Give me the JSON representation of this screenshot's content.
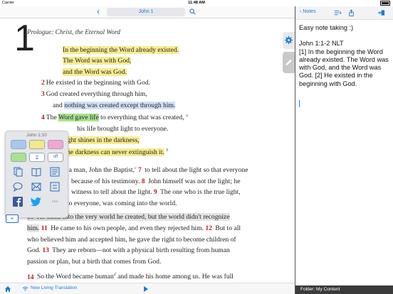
{
  "status": {
    "carrier": "Carrier",
    "time": "11:48 AM"
  },
  "reader": {
    "reference": "John 1",
    "heading": "Prologue: Christ, the Eternal Word",
    "chapter_number": "1",
    "lines": {
      "l1": "In the beginning the Word already existed.",
      "l2": "The Word was with God,",
      "l3": "and the Word was God.",
      "v2": "2",
      "l4": "He existed in the beginning with God.",
      "v3": "3",
      "l5": "God created everything through him,",
      "l6a": "and ",
      "l6b": "nothing was created except through him.",
      "v4": "4",
      "l7a": "The ",
      "l7b": "Word gave life",
      "l7c": " to everything that was created,",
      "fn_a": "a",
      "l8": "his life brought light to everyone.",
      "l9": "ight shines in the darkness,",
      "l10": "he darkness can never extinguish it.",
      "fn_b": "b",
      "p1a": "God sent a man, John the Baptist,",
      "fn_c": "c",
      "v7": "7",
      "p1b": " to tell about the light so that everyone",
      "p2": "because of his testimony. ",
      "v8": "8",
      "p2b": " John himself was not the light; he",
      "p3": "witness to tell about the light. ",
      "v9": "9",
      "p3b": " The one who is the true light,",
      "p4": "to everyone, was coming into the world.",
      "v10": "10",
      "p5": " He came into the very world he created, but the world didn't recognize",
      "p6a": "him.",
      "v11": "11",
      "p6b": " He came to his own people, and even they rejected him. ",
      "v12": "12",
      "p6c": " But to all",
      "p7": "who believed him and accepted him, he gave the right to become children of",
      "p8a": "God. ",
      "v13": "13",
      "p8b": " They are reborn—not with a physical birth resulting from human",
      "p9": "passion or plan, but a birth that comes from God.",
      "v14": "14",
      "p10a": " So the Word became human",
      "fn_d": "d",
      "p10b": " and made his home among us. He was full"
    },
    "translation": "New Living Translation"
  },
  "highlight_panel": {
    "title": "John 1:10",
    "swatches": [
      {
        "color": "#a8c8f0",
        "label": ""
      },
      {
        "color": "#f4e98a",
        "label": ""
      },
      {
        "color": "#f4a6d0",
        "label": ""
      },
      {
        "color": "#a6e38e",
        "label": ""
      },
      {
        "color": "#ffffff",
        "label": "u"
      },
      {
        "color": "#ffffff",
        "label": "off"
      }
    ],
    "icons": [
      "copy-icon",
      "book-icon",
      "list-icon",
      "comment-icon",
      "email-icon",
      "share-icon",
      "facebook-icon",
      "twitter-icon",
      "more-icon"
    ],
    "more_label": "◦◦◦",
    "add_label": "+"
  },
  "notes": {
    "back_label": "Notes",
    "title": "Easy note taking :)",
    "ref": "John 1:1-2 NLT",
    "body": "[1] In the beginning the Word already existed. The Word was with God, and the Word was God. [2] He existed in the beginning with God.",
    "folder": "Folder: My Content"
  },
  "colors": {
    "accent": "#1a7bd6",
    "verse_number": "#b22222"
  }
}
